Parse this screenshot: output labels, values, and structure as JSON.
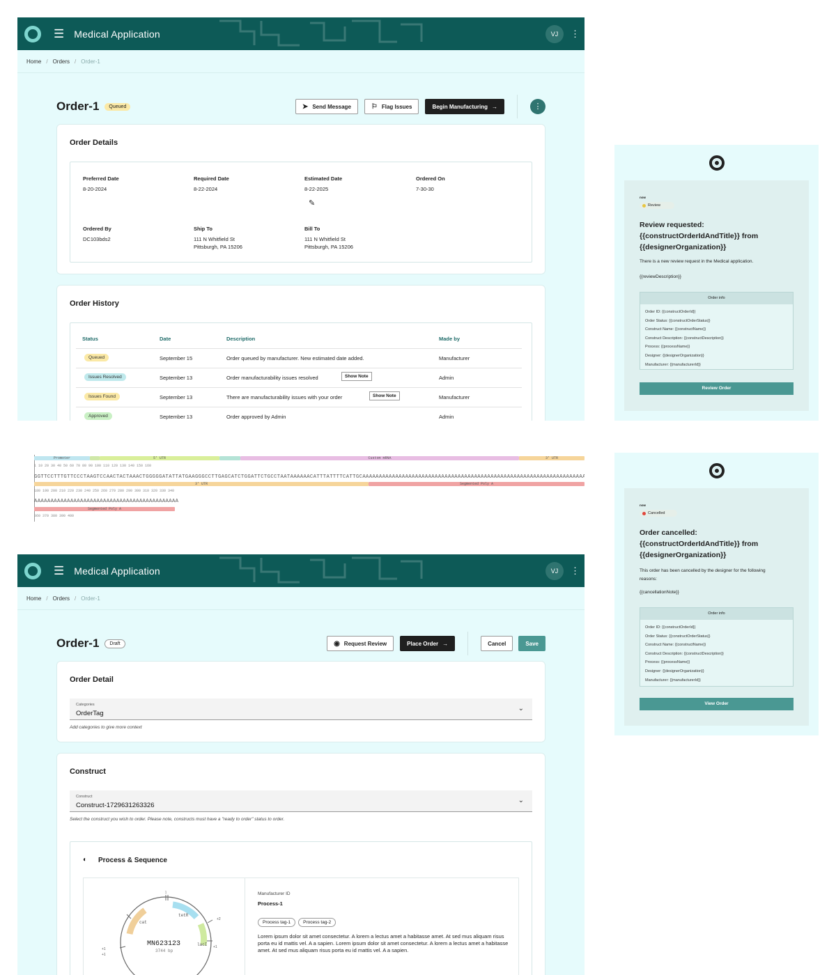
{
  "screen1": {
    "app_title": "Medical Application",
    "avatar": "VJ",
    "breadcrumb": [
      "Home",
      "Orders",
      "Order-1"
    ],
    "order_title": "Order-1",
    "status_badge": "Queued",
    "buttons": {
      "send": "Send Message",
      "flag": "Flag Issues",
      "begin": "Begin Manufacturing"
    },
    "details_title": "Order Details",
    "details": {
      "preferred_label": "Preferred Date",
      "preferred": "8-20-2024",
      "required_label": "Required Date",
      "required": "8-22-2024",
      "estimated_label": "Estimated Date",
      "estimated": "8-22-2025",
      "ordered_on_label": "Ordered On",
      "ordered_on": "7-30-30",
      "ordered_by_label": "Ordered By",
      "ordered_by": "DC103bds2",
      "ship_to_label": "Ship To",
      "ship_to_1": "111 N Whitfield St",
      "ship_to_2": "Pittsburgh, PA 15206",
      "bill_to_label": "Bill To",
      "bill_to_1": "111 N Whitfield St",
      "bill_to_2": "Pittsburgh, PA 15206"
    },
    "history_title": "Order History",
    "history_headers": [
      "Status",
      "Date",
      "Description",
      "Made by"
    ],
    "history": [
      {
        "status": "Queued",
        "date": "September 15",
        "desc": "Order queued by manufacturer. New estimated date added.",
        "by": "Manufacturer"
      },
      {
        "status": "Issues Resolved",
        "date": "September 13",
        "desc": "Order manufacturability issues resolved",
        "by": "Admin",
        "note": "Show Note"
      },
      {
        "status": "Issues Found",
        "date": "September 13",
        "desc": "There are manufacturability issues with your order",
        "by": "Manufacturer",
        "note": "Show Note"
      },
      {
        "status": "Approved",
        "date": "September 13",
        "desc": "Order approved by Admin",
        "by": "Admin"
      }
    ]
  },
  "sequence": {
    "features_row1": [
      "Promoter",
      "5' UTR",
      "Custom mRNA",
      "3' UTR"
    ],
    "ticks_row1": "1        10        20        30        40        50        60        70        80        90        100       110       120       130       140       150       160",
    "seq_row2": "GGTTCCTTTGTTCCCTAAGTCCAACTACTAAACTGGGGGATATTATGAAGGGCCTTGAGCATCTGGATTCTGCCTAATAAAAAACATTTATTTTCATTGCAAAAAAAAAAAAAAAAAAAAAAAAAAAAAAAAAAAAAAAAAAAAAAAAAAAAAAAAAAAAAAAAAAAAAAAAAAAAAGAAAAAAA",
    "features_row2": [
      "3' UTR",
      "Segmented Poly A"
    ],
    "ticks_row2": "180       190       200       210       220       230       240       250       260       270       280       290       300       310       320       330       340",
    "seq_row3": "AAAAAAAAAAAAAAAAAAAAAAAAAAAAAAAAAAAAAAAAAAAA",
    "features_row3": [
      "Segmented Poly A"
    ],
    "ticks_row3": "360       370       380       390       400"
  },
  "screen2": {
    "app_title": "Medical Application",
    "avatar": "VJ",
    "breadcrumb": [
      "Home",
      "Orders",
      "Order-1"
    ],
    "order_title": "Order-1",
    "status_badge": "Draft",
    "buttons": {
      "review": "Request Review",
      "place": "Place Order",
      "cancel": "Cancel",
      "save": "Save"
    },
    "detail_title": "Order Detail",
    "categories_label": "Categories",
    "categories_value": "OrderTag",
    "categories_hint": "Add categories to give more context",
    "construct_title": "Construct",
    "construct_label": "Construct",
    "construct_value": "Construct-1729631263326",
    "construct_hint": "Select the construct you wish to order. Please note, constructs must have a \"ready to order\" status to order.",
    "process_title": "Process & Sequence",
    "plasmid_name": "MN623123",
    "plasmid_len": "3744 bp",
    "plasmid_features": [
      "cat",
      "tetR",
      "lacI"
    ],
    "manufacturer_id_label": "Manufacturer ID",
    "process_name": "Process-1",
    "tags": [
      "Process tag-1",
      "Process tag-2"
    ],
    "lorem": "Lorem ipsum dolor sit amet consectetur. A lorem a lectus amet a habitasse amet. At sed mus aliquam risus porta eu id mattis vel. A a sapien. Lorem ipsum dolor sit amet consectetur. A lorem a lectus amet a habitasse amet. At sed mus aliquam risus porta eu id mattis vel. A a sapien."
  },
  "email1": {
    "now": "now",
    "status": "Review",
    "title": "Review requested: {{constructOrderIdAndTitle}} from {{designerOrganization}}",
    "body": "There is a new review request in the Medical application.",
    "placeholder": "{{reviewDescription}}",
    "info_title": "Order info",
    "info_lines": [
      "Order ID: {{constructOrderId}}",
      "Order Status: {{constructOrderStatus}}",
      "Construct Name: {{constructName}}",
      "Construct Description: {{constructDescription}}",
      "Process: {{processName}}",
      "Designer: {{designerOrganization}}",
      "Manufacturer: {{manufacturerId}}"
    ],
    "button": "Review Order"
  },
  "email2": {
    "now": "now",
    "status": "Cancelled",
    "title": "Order cancelled: {{constructOrderIdAndTitle}} from {{designerOrganization}}",
    "body": "This order has been cancelled by the designer for the following reasons:",
    "placeholder": "{{cancellationNote}}",
    "info_title": "Order info",
    "info_lines": [
      "Order ID: {{constructOrderId}}",
      "Order Status: {{constructOrderStatus}}",
      "Construct Name: {{constructName}}",
      "Construct Description: {{constructDescription}}",
      "Process: {{processName}}",
      "Designer: {{designerOrganization}}",
      "Manufacturer: {{manufacturerId}}"
    ],
    "button": "View Order"
  },
  "colors": {
    "appbar": "#0d5a57",
    "accent": "#4a9893",
    "queued": "#fbe9a6",
    "resolved": "#bfe9ec",
    "approved": "#c9f0c4",
    "cancelled_dot": "#e0463b",
    "review_dot": "#e8c640"
  }
}
